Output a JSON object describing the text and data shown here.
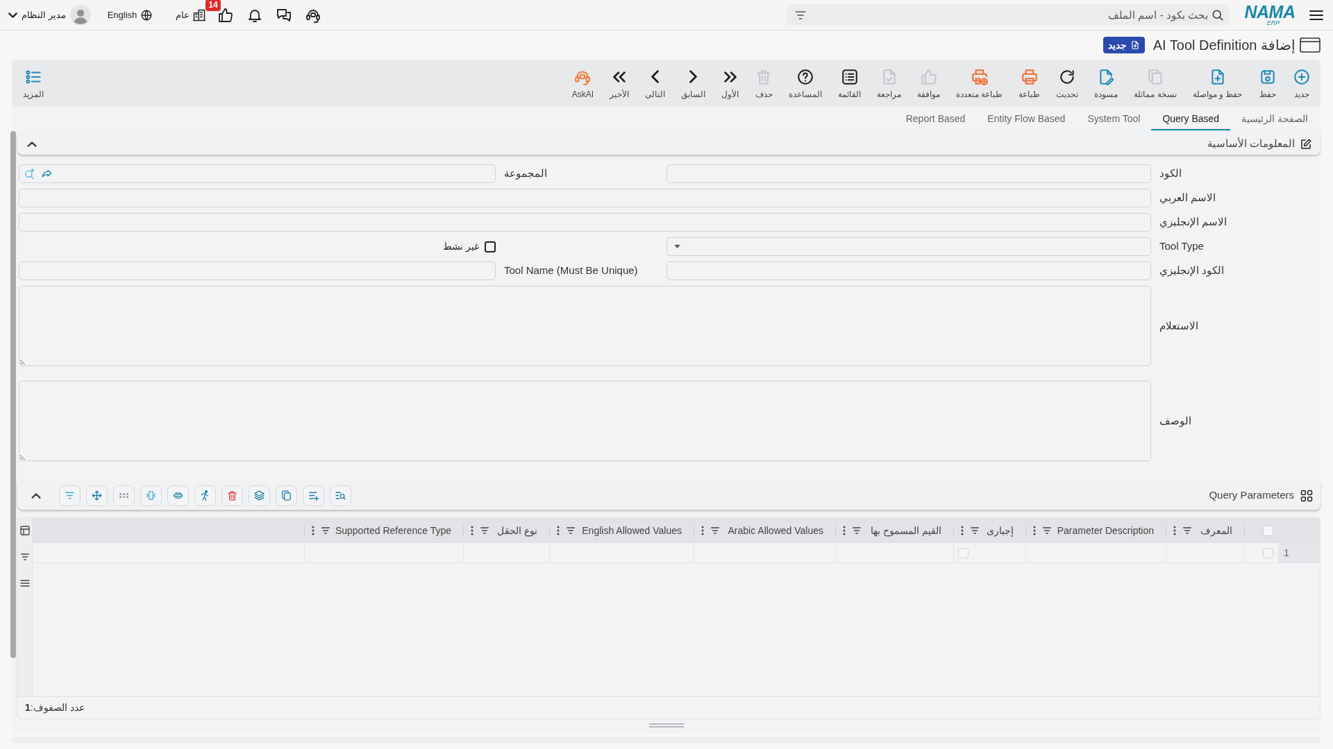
{
  "topbar": {
    "logo": {
      "text": "NAMA",
      "sub": "ERP"
    },
    "search": {
      "placeholder": "بحث بكود - اسم الملف"
    },
    "likes_badge": "14",
    "branch": "عام",
    "language": "English",
    "user": "مدير النظام"
  },
  "page_title": {
    "text": "إضافة AI Tool Definition",
    "badge": "جديد"
  },
  "toolbar": {
    "items": [
      {
        "kind": "new",
        "label": "جديد",
        "disabled": false
      },
      {
        "kind": "save",
        "label": "حفظ",
        "disabled": false
      },
      {
        "kind": "save_continue",
        "label": "حفظ و مواصلة",
        "disabled": false
      },
      {
        "kind": "duplicate",
        "label": "نسخة مماثلة",
        "disabled": true
      },
      {
        "kind": "draft",
        "label": "مسودة",
        "disabled": false
      },
      {
        "kind": "refresh",
        "label": "تحديث",
        "disabled": false
      },
      {
        "kind": "print",
        "label": "طباعة",
        "disabled": false
      },
      {
        "kind": "multi_print",
        "label": "طباعة متعددة",
        "disabled": false
      },
      {
        "kind": "approve",
        "label": "موافقة",
        "disabled": true
      },
      {
        "kind": "review",
        "label": "مراجعة",
        "disabled": true
      },
      {
        "kind": "list",
        "label": "القائمة",
        "disabled": false
      },
      {
        "kind": "help",
        "label": "المساعدة",
        "disabled": false
      },
      {
        "kind": "delete",
        "label": "حذف",
        "disabled": true
      },
      {
        "kind": "first",
        "label": "الأول",
        "disabled": false
      },
      {
        "kind": "previous",
        "label": "السابق",
        "disabled": false
      },
      {
        "kind": "next",
        "label": "التالي",
        "disabled": false
      },
      {
        "kind": "last",
        "label": "الأخير",
        "disabled": false
      },
      {
        "kind": "ask_ai",
        "label": "AskAI",
        "disabled": false
      }
    ],
    "more": "المزيد"
  },
  "tabs": [
    {
      "label": "الصفحة الرئيسية",
      "selected": false
    },
    {
      "label": "Query Based",
      "selected": true
    },
    {
      "label": "System Tool",
      "selected": false
    },
    {
      "label": "Entity Flow Based",
      "selected": false
    },
    {
      "label": "Report Based",
      "selected": false
    }
  ],
  "basic_info": {
    "title": "المعلومات الأساسية",
    "expanded": true,
    "rows": [
      [
        {
          "kind": "text",
          "label": "الكود"
        },
        {
          "kind": "lookup",
          "label": "المجموعة"
        }
      ],
      [
        {
          "kind": "text",
          "label": "الاسم العربي"
        }
      ],
      [
        {
          "kind": "text",
          "label": "الاسم الإنجليزي"
        }
      ],
      [
        {
          "kind": "select",
          "label": "Tool Type"
        },
        {
          "kind": "checkbox",
          "label": "غير نشط",
          "checked": false
        }
      ],
      [
        {
          "kind": "text",
          "label": "الكود الإنجليزي"
        },
        {
          "kind": "text",
          "label": "Tool Name (Must Be Unique)"
        }
      ],
      [
        {
          "kind": "textarea",
          "label": "الاستعلام"
        }
      ],
      [
        {
          "kind": "textarea",
          "label": "الوصف"
        }
      ]
    ]
  },
  "query_parameters": {
    "title": "Query Parameters",
    "expanded": true,
    "all_selected": false,
    "columns": [
      {
        "kind": "text",
        "label": "المعرف"
      },
      {
        "kind": "text",
        "label": "Parameter Description"
      },
      {
        "kind": "checkbox",
        "label": "إجبارى"
      },
      {
        "kind": "text",
        "label": "القيم المسموح بها"
      },
      {
        "kind": "text",
        "label": "Arabic Allowed Values"
      },
      {
        "kind": "text",
        "label": "English Allowed Values"
      },
      {
        "kind": "text",
        "label": "نوع الحقل"
      },
      {
        "kind": "text",
        "label": "Supported Reference Type"
      }
    ],
    "rows": [
      {
        "number": "1",
        "selected": false,
        "checked": false
      }
    ],
    "row_count": "عدد الصفوف:**1**"
  }
}
